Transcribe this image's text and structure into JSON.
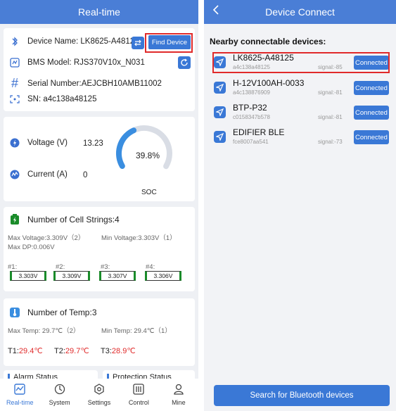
{
  "realtime": {
    "title": "Real-time",
    "device": {
      "name_label": "Device Name: LK8625-A48125",
      "find_button": "Find Device",
      "bms_label": "BMS Model: RJS370V10x_N031",
      "serial_label": "Serial Number:AEJCBH10AMB11002",
      "sn_label": "SN:  a4c138a48125"
    },
    "power": {
      "voltage_label": "Voltage (V)",
      "voltage_value": "13.23",
      "current_label": "Current (A)",
      "current_value": "0",
      "soc_percent_text": "39.8%",
      "soc_value": 39.8,
      "soc_label": "SOC"
    },
    "cells": {
      "title": "Number of Cell Strings:4",
      "max_voltage": "Max Voltage:3.309V（2）",
      "min_voltage": "Min Voltage:3.303V（1）",
      "max_dp": "Max DP:0.006V",
      "items": [
        {
          "label": "#1:",
          "value": "3.303V"
        },
        {
          "label": "#2:",
          "value": "3.309V"
        },
        {
          "label": "#3:",
          "value": "3.307V"
        },
        {
          "label": "#4:",
          "value": "3.306V"
        }
      ]
    },
    "temp": {
      "title": "Number of Temp:3",
      "max_temp": "Max Temp: 29.7℃（2）",
      "min_temp": "Min Temp: 29.4℃（1）",
      "t1_label": "T1:",
      "t1_value": "29.4℃",
      "t2_label": "T2:",
      "t2_value": "29.7℃",
      "t3_label": "T3:",
      "t3_value": "28.9℃"
    },
    "status": {
      "alarm": "Alarm Status",
      "protection": "Protection Status"
    },
    "tabs": [
      {
        "label": "Real-time",
        "icon": "realtime-icon"
      },
      {
        "label": "System",
        "icon": "system-icon"
      },
      {
        "label": "Settings",
        "icon": "settings-icon"
      },
      {
        "label": "Control",
        "icon": "control-icon"
      },
      {
        "label": "Mine",
        "icon": "mine-icon"
      }
    ]
  },
  "connect": {
    "title": "Device Connect",
    "back_icon": "chevron-left-icon",
    "nearby_label": "Nearby connectable devices:",
    "devices": [
      {
        "name": "LK8625-A48125",
        "mac": "a4c138a48125",
        "signal": "signal:-85",
        "button": "Connected"
      },
      {
        "name": "H-12V100AH-0033",
        "mac": "a4c138876909",
        "signal": "signal:-81",
        "button": "Connected"
      },
      {
        "name": "BTP-P32",
        "mac": "c0158347b578",
        "signal": "signal:-81",
        "button": "Connected"
      },
      {
        "name": "EDIFIER BLE",
        "mac": "fce8007aa541",
        "signal": "signal:-73",
        "button": "Connected"
      }
    ],
    "search_button": "Search for Bluetooth devices"
  },
  "colors": {
    "primary": "#3a78d6",
    "header": "#4a7ed6",
    "highlight": "#e02a2a",
    "temp_red": "#e02a2a",
    "cell_green": "#1a8c2a"
  }
}
